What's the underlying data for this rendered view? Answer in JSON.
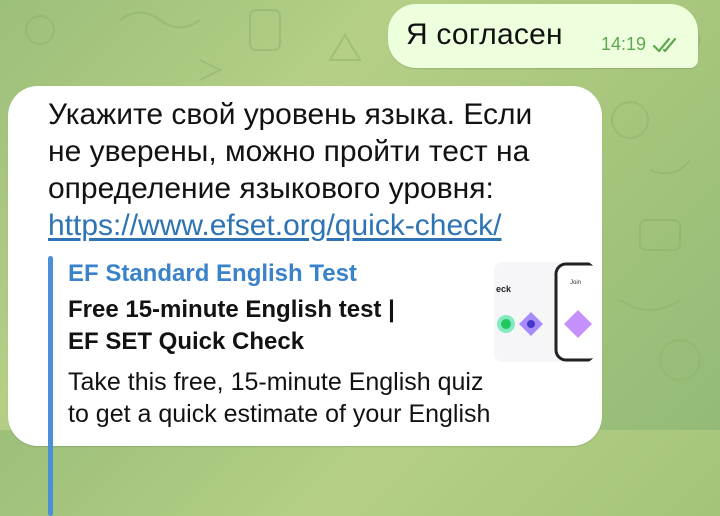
{
  "outgoing": {
    "text": "Я согласен",
    "time": "14:19",
    "status_icon": "double-check-icon"
  },
  "incoming": {
    "lines": [
      "Укажите свой уровень языка. Если",
      "не уверены, можно пройти тест на",
      "определение языкового уровня:"
    ],
    "link": "https://www.efset.org/quick-check/",
    "preview": {
      "site_name": "EF Standard English Test",
      "title_lines": [
        "Free 15-minute English test |",
        "EF SET Quick Check"
      ],
      "description_lines": [
        "Take this free, 15-minute English quiz",
        "to get a quick estimate of your English"
      ],
      "thumbnail_text": "eck",
      "thumbnail_side_text": "Join"
    }
  },
  "colors": {
    "outgoing_bubble": "#eeffde",
    "incoming_bubble": "#ffffff",
    "link": "#2e74b5",
    "preview_accent": "#4a90d9",
    "time": "#5fa651"
  }
}
